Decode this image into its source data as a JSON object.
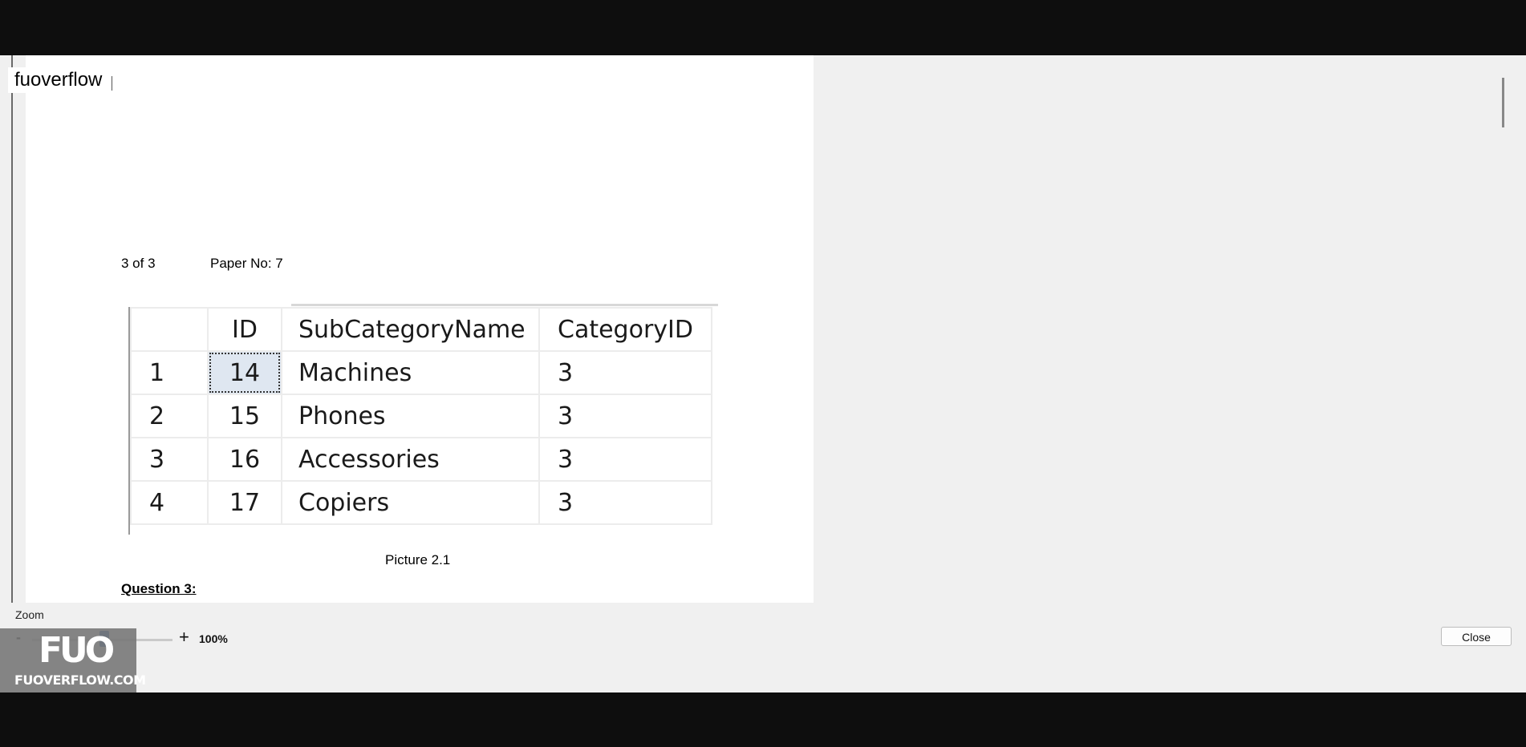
{
  "header": {
    "filename_tag": "fuoverflow"
  },
  "document": {
    "pager": "3 of 3",
    "paper_no": "Paper No: 7",
    "table": {
      "columns": [
        "",
        "ID",
        "SubCategoryName",
        "CategoryID"
      ],
      "rows": [
        [
          "1",
          "14",
          "Machines",
          "3"
        ],
        [
          "2",
          "15",
          "Phones",
          "3"
        ],
        [
          "3",
          "16",
          "Accessories",
          "3"
        ],
        [
          "4",
          "17",
          "Copiers",
          "3"
        ]
      ]
    },
    "caption": "Picture 2.1",
    "question": "Question 3:"
  },
  "zoom": {
    "label": "Zoom",
    "minus": "-",
    "plus": "+",
    "value": "100%"
  },
  "buttons": {
    "close": "Close"
  },
  "watermark": {
    "mark": "FUO",
    "text": "FUOVERFLOW.COM"
  },
  "colors": {
    "selection": "#dfe7f1",
    "slider_thumb": "#1e5aa8",
    "page_background": "#ffffff",
    "app_background": "#f0f0f0"
  }
}
